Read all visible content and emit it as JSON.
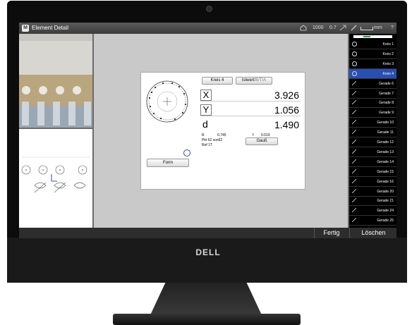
{
  "window": {
    "title": "Element Detail",
    "icon": "M"
  },
  "status": {
    "value1": "1000",
    "value2": "0.7",
    "unit": "mm",
    "help": "?"
  },
  "panel": {
    "element_button": "Kreis 4",
    "mode_button_main": "Istwert",
    "mode_button_rest": "/B/T/A",
    "x_label": "X",
    "x_value": "3.926",
    "y_label": "Y",
    "y_value": "1.056",
    "d_label": "d",
    "d_value": "1.490",
    "r_label": "R",
    "r_value": "0.745",
    "f_label": "f",
    "f_value": "0.019",
    "pkt_text": "Pkt 62 von62",
    "ref_text": "Ref 1T",
    "gauss_button": "Gauß",
    "form_button": "Form"
  },
  "elements": [
    {
      "label": "Kreis 1",
      "icon": "circle",
      "selected": false
    },
    {
      "label": "Kreis 2",
      "icon": "circle",
      "selected": false
    },
    {
      "label": "Kreis 3",
      "icon": "circle",
      "selected": false
    },
    {
      "label": "Kreis 4",
      "icon": "circle",
      "selected": true
    },
    {
      "label": "Gerade 6",
      "icon": "line",
      "selected": false
    },
    {
      "label": "Gerade 7",
      "icon": "line",
      "selected": false
    },
    {
      "label": "Gerade 8",
      "icon": "line",
      "selected": false
    },
    {
      "label": "Gerade 9",
      "icon": "line",
      "selected": false
    },
    {
      "label": "Gerade 10",
      "icon": "line",
      "selected": false
    },
    {
      "label": "Gerade 11",
      "icon": "line",
      "selected": false
    },
    {
      "label": "Gerade 12",
      "icon": "line",
      "selected": false
    },
    {
      "label": "Gerade 13",
      "icon": "line",
      "selected": false
    },
    {
      "label": "Gerade 14",
      "icon": "line",
      "selected": false
    },
    {
      "label": "Gerade 15",
      "icon": "line",
      "selected": false
    },
    {
      "label": "Gerade 16",
      "icon": "line",
      "selected": false
    },
    {
      "label": "Gerade 20",
      "icon": "line",
      "selected": false
    },
    {
      "label": "Gerade 21",
      "icon": "line",
      "selected": false
    },
    {
      "label": "Gerade 24",
      "icon": "line",
      "selected": false
    },
    {
      "label": "Gerade 25",
      "icon": "line",
      "selected": false
    }
  ],
  "bottom": {
    "done": "Fertig",
    "delete": "Löschen"
  },
  "monitor": {
    "brand": "DELL"
  },
  "colors": {
    "selected": "#2a4fb0",
    "list_bg": "#000000",
    "canvas": "#c9c9c9"
  }
}
